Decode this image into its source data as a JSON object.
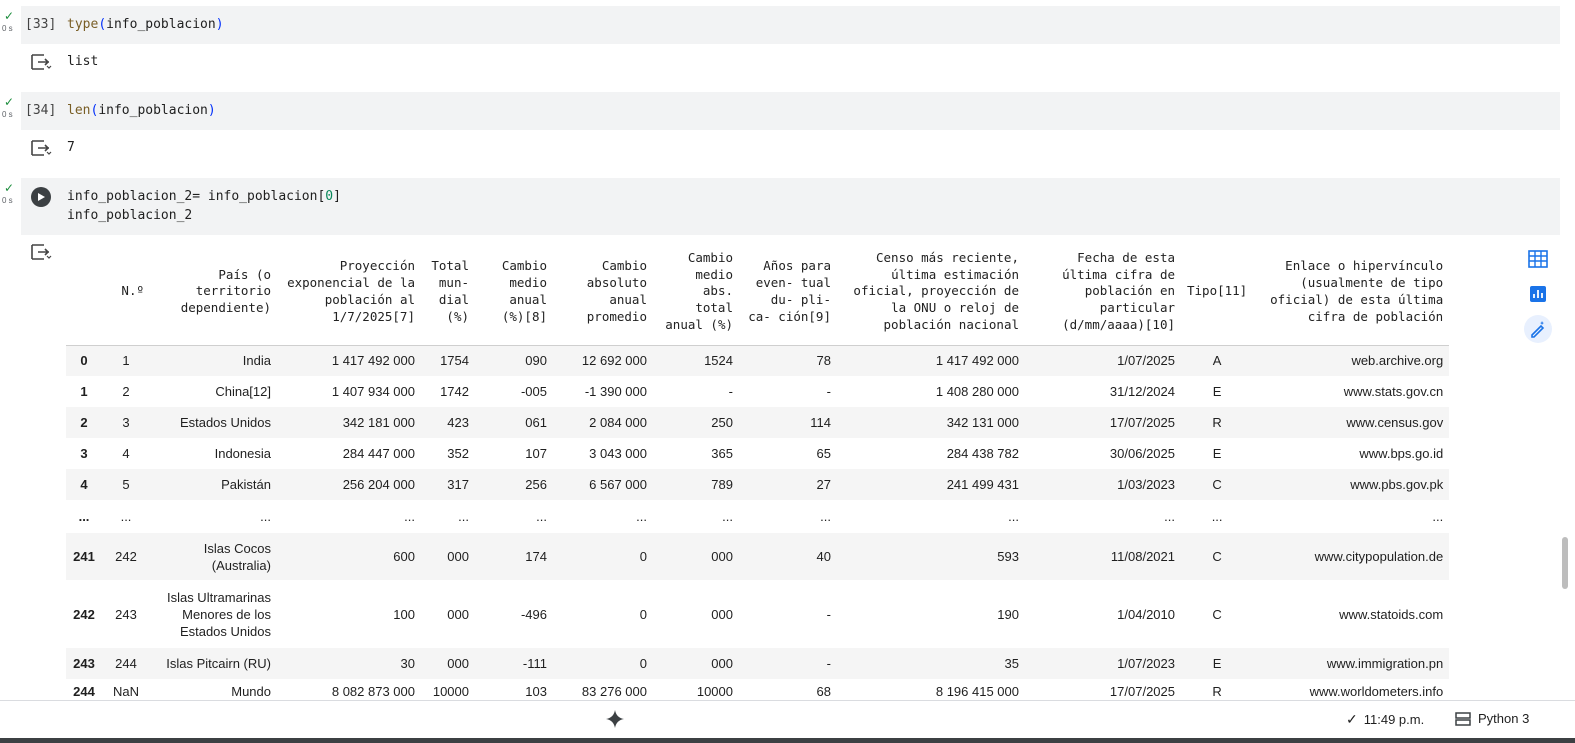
{
  "cells": [
    {
      "exec": "[33]",
      "time": "0 s",
      "code": [
        {
          "fn": "type",
          "arg": "info_poblacion"
        }
      ],
      "output": "list"
    },
    {
      "exec": "[34]",
      "time": "0 s",
      "code": [
        {
          "fn": "len",
          "arg": "info_poblacion"
        }
      ],
      "output": "7"
    },
    {
      "time": "0 s",
      "line1_prefix": "info_poblacion_2= info_poblacion[",
      "line1_index": "0",
      "line1_suffix": "]",
      "line2": "info_poblacion_2"
    }
  ],
  "table": {
    "headers": [
      "",
      "N.º",
      "País (o territorio dependiente)",
      "Proyección exponencial de la población al 1/7/2025[7]",
      "Total mun- dial (%)",
      "Cambio medio anual (%)[8]",
      "Cambio absoluto anual promedio",
      "Cambio medio abs. total anual (%)",
      "Años para even- tual du- pli- ca- ción[9]",
      "Censo más reciente, última estimación oficial, proyección de la ONU o reloj de población nacional",
      "Fecha de esta última cifra de población en particular (d/mm/aaaa)[10]",
      "Tipo[11]",
      "Enlace o hipervínculo (usualmente de tipo oficial) de esta última cifra de población"
    ],
    "rows": [
      [
        "0",
        "1",
        "India",
        "1 417 492 000",
        "1754",
        "090",
        "12 692 000",
        "1524",
        "78",
        "1 417 492 000",
        "1/07/2025",
        "A",
        "web.archive.org"
      ],
      [
        "1",
        "2",
        "China[12]",
        "1 407 934 000",
        "1742",
        "-005",
        "-1 390 000",
        "-",
        "-",
        "1 408 280 000",
        "31/12/2024",
        "E",
        "www.stats.gov.cn"
      ],
      [
        "2",
        "3",
        "Estados Unidos",
        "342 181 000",
        "423",
        "061",
        "2 084 000",
        "250",
        "114",
        "342 131 000",
        "17/07/2025",
        "R",
        "www.census.gov"
      ],
      [
        "3",
        "4",
        "Indonesia",
        "284 447 000",
        "352",
        "107",
        "3 043 000",
        "365",
        "65",
        "284 438 782",
        "30/06/2025",
        "E",
        "www.bps.go.id"
      ],
      [
        "4",
        "5",
        "Pakistán",
        "256 204 000",
        "317",
        "256",
        "6 567 000",
        "789",
        "27",
        "241 499 431",
        "1/03/2023",
        "C",
        "www.pbs.gov.pk"
      ],
      [
        "...",
        "...",
        "...",
        "...",
        "...",
        "...",
        "...",
        "...",
        "...",
        "...",
        "...",
        "...",
        "..."
      ],
      [
        "241",
        "242",
        "Islas Cocos (Australia)",
        "600",
        "000",
        "174",
        "0",
        "000",
        "40",
        "593",
        "11/08/2021",
        "C",
        "www.citypopulation.de"
      ],
      [
        "242",
        "243",
        "Islas Ultramarinas Menores de los Estados Unidos",
        "100",
        "000",
        "-496",
        "0",
        "000",
        "-",
        "190",
        "1/04/2010",
        "C",
        "www.statoids.com"
      ],
      [
        "243",
        "244",
        "Islas Pitcairn (RU)",
        "30",
        "000",
        "-111",
        "0",
        "000",
        "-",
        "35",
        "1/07/2023",
        "E",
        "www.immigration.pn"
      ],
      [
        "244",
        "NaN",
        "Mundo",
        "8 082 873 000",
        "10000",
        "103",
        "83 276 000",
        "10000",
        "68",
        "8 196 415 000",
        "17/07/2025",
        "R",
        "www.worldometers.info"
      ]
    ]
  },
  "side_tools": [
    "table-icon",
    "chart-icon",
    "magic-pen-icon"
  ],
  "status": {
    "time": "11:49 p.m.",
    "runtime": "Python 3"
  },
  "colors": {
    "check": "#1e8e3e",
    "code_bg": "#f2f3f4",
    "accent": "#1a73e8"
  }
}
